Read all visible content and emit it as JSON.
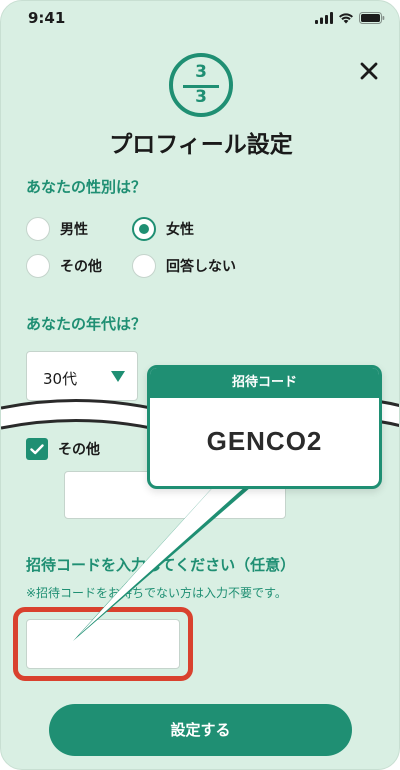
{
  "status_bar": {
    "time": "9:41"
  },
  "step": {
    "current": "3",
    "total": "3"
  },
  "title": "プロフィール設定",
  "gender": {
    "label": "あなたの性別は？",
    "options": [
      "男性",
      "女性",
      "その他",
      "回答しない"
    ],
    "selected": "女性"
  },
  "age": {
    "label": "あなたの年代は？",
    "selected": "30代"
  },
  "other_check": {
    "label": "その他",
    "checked": true
  },
  "callout": {
    "header": "招待コード",
    "code": "GENCO2"
  },
  "invite": {
    "label": "招待コードを入力してください（任意）",
    "note": "※招待コードをお持ちでない方は入力不要です。",
    "value": ""
  },
  "submit": {
    "label": "設定する"
  },
  "colors": {
    "accent": "#1f8f73",
    "background": "#d9efe3",
    "highlight": "#d9412e"
  }
}
